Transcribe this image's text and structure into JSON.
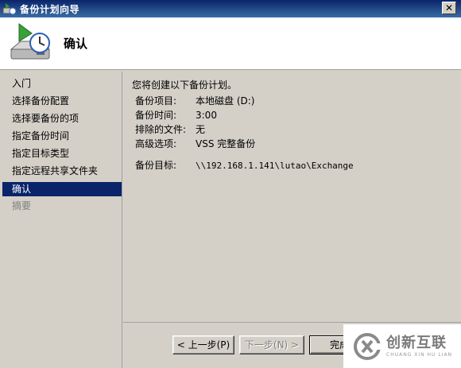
{
  "window": {
    "title": "备份计划向导"
  },
  "header": {
    "title": "确认"
  },
  "nav": {
    "items": [
      {
        "label": "入门"
      },
      {
        "label": "选择备份配置"
      },
      {
        "label": "选择要备份的项"
      },
      {
        "label": "指定备份时间"
      },
      {
        "label": "指定目标类型"
      },
      {
        "label": "指定远程共享文件夹"
      },
      {
        "label": "确认",
        "state": "selected"
      },
      {
        "label": "摘要",
        "state": "disabled"
      }
    ]
  },
  "content": {
    "intro": "您将创建以下备份计划。",
    "details": [
      {
        "key": "备份项目:",
        "value": "本地磁盘 (D:)"
      },
      {
        "key": "备份时间:",
        "value": "3:00"
      },
      {
        "key": "排除的文件:",
        "value": "无"
      },
      {
        "key": "高级选项:",
        "value": "VSS 完整备份"
      }
    ],
    "target": {
      "key": "备份目标:",
      "value": "\\\\192.168.1.141\\lutao\\Exchange"
    }
  },
  "buttons": {
    "back": "< 上一步(P)",
    "next": "下一步(N) >",
    "finish": "完成"
  },
  "watermark": {
    "main": "创新互联",
    "sub": "CHUANG XIN HU LIAN"
  },
  "colors": {
    "titlebar": "#0a246a",
    "selected": "#0a246a",
    "face": "#d4d0c8"
  }
}
